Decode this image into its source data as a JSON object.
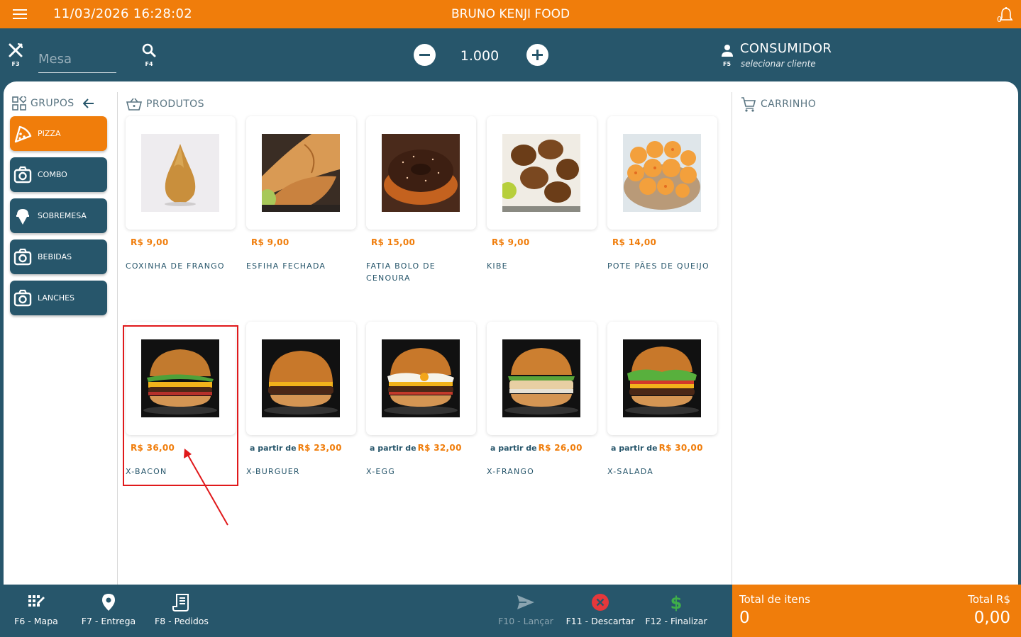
{
  "header": {
    "datetime": "11/03/2026 16:28:02",
    "brand": "BRUNO KENJI FOOD",
    "bell_count": "0"
  },
  "toolbar": {
    "table_key": "F3",
    "table_placeholder": "Mesa",
    "search_key": "F4",
    "quantity": "1.000",
    "customer_name": "CONSUMIDOR",
    "customer_key": "F5",
    "customer_action": "selecionar cliente"
  },
  "groups": {
    "title": "GRUPOS",
    "items": [
      {
        "label": "PIZZA",
        "icon": "pizza-icon",
        "active": true
      },
      {
        "label": "COMBO",
        "icon": "camera-icon",
        "active": false
      },
      {
        "label": "SOBREMESA",
        "icon": "ice-cream-icon",
        "active": false
      },
      {
        "label": "BEBIDAS",
        "icon": "camera-icon",
        "active": false
      },
      {
        "label": "LANCHES",
        "icon": "camera-icon",
        "active": false
      }
    ]
  },
  "products": {
    "title": "PRODUTOS",
    "items": [
      {
        "price_prefix": "",
        "price": "R$ 9,00",
        "name": "COXINHA DE FRANGO",
        "image": "coxinha"
      },
      {
        "price_prefix": "",
        "price": "R$ 9,00",
        "name": "ESFIHA FECHADA",
        "image": "esfiha"
      },
      {
        "price_prefix": "",
        "price": "R$ 15,00",
        "name": "FATIA BOLO DE CENOURA",
        "image": "bolo"
      },
      {
        "price_prefix": "",
        "price": "R$ 9,00",
        "name": "KIBE",
        "image": "kibe"
      },
      {
        "price_prefix": "",
        "price": "R$ 14,00",
        "name": "POTE PÃES DE QUEIJO",
        "image": "pao-de-queijo"
      },
      {
        "price_prefix": "",
        "price": "R$ 36,00",
        "name": "X-BACON",
        "image": "burger"
      },
      {
        "price_prefix": "a partir de",
        "price": "R$ 23,00",
        "name": "X-BURGUER",
        "image": "burger"
      },
      {
        "price_prefix": "a partir de",
        "price": "R$ 32,00",
        "name": "X-EGG",
        "image": "burger-egg"
      },
      {
        "price_prefix": "a partir de",
        "price": "R$ 26,00",
        "name": "X-FRANGO",
        "image": "burger"
      },
      {
        "price_prefix": "a partir de",
        "price": "R$ 30,00",
        "name": "X-SALADA",
        "image": "burger"
      }
    ]
  },
  "cart": {
    "title": "CARRINHO"
  },
  "footer": {
    "buttons": [
      {
        "label": "F6 - Mapa",
        "icon": "map-grid-icon",
        "enabled": true
      },
      {
        "label": "F7 - Entrega",
        "icon": "location-pin-icon",
        "enabled": true
      },
      {
        "label": "F8 - Pedidos",
        "icon": "receipt-icon",
        "enabled": true
      },
      {
        "label": "F10 - Lançar",
        "icon": "send-icon",
        "enabled": false
      },
      {
        "label": "F11 - Descartar",
        "icon": "discard-icon",
        "enabled": true
      },
      {
        "label": "F12 - Finalizar",
        "icon": "dollar-icon",
        "enabled": true
      }
    ],
    "total_items_label": "Total de itens",
    "total_items_value": "0",
    "total_price_label": "Total R$",
    "total_price_value": "0,00"
  },
  "colors": {
    "accent": "#f07d0b",
    "primary": "#27566b",
    "discard": "#e5383b",
    "finalize": "#3fae49",
    "highlight": "#e0191b"
  }
}
